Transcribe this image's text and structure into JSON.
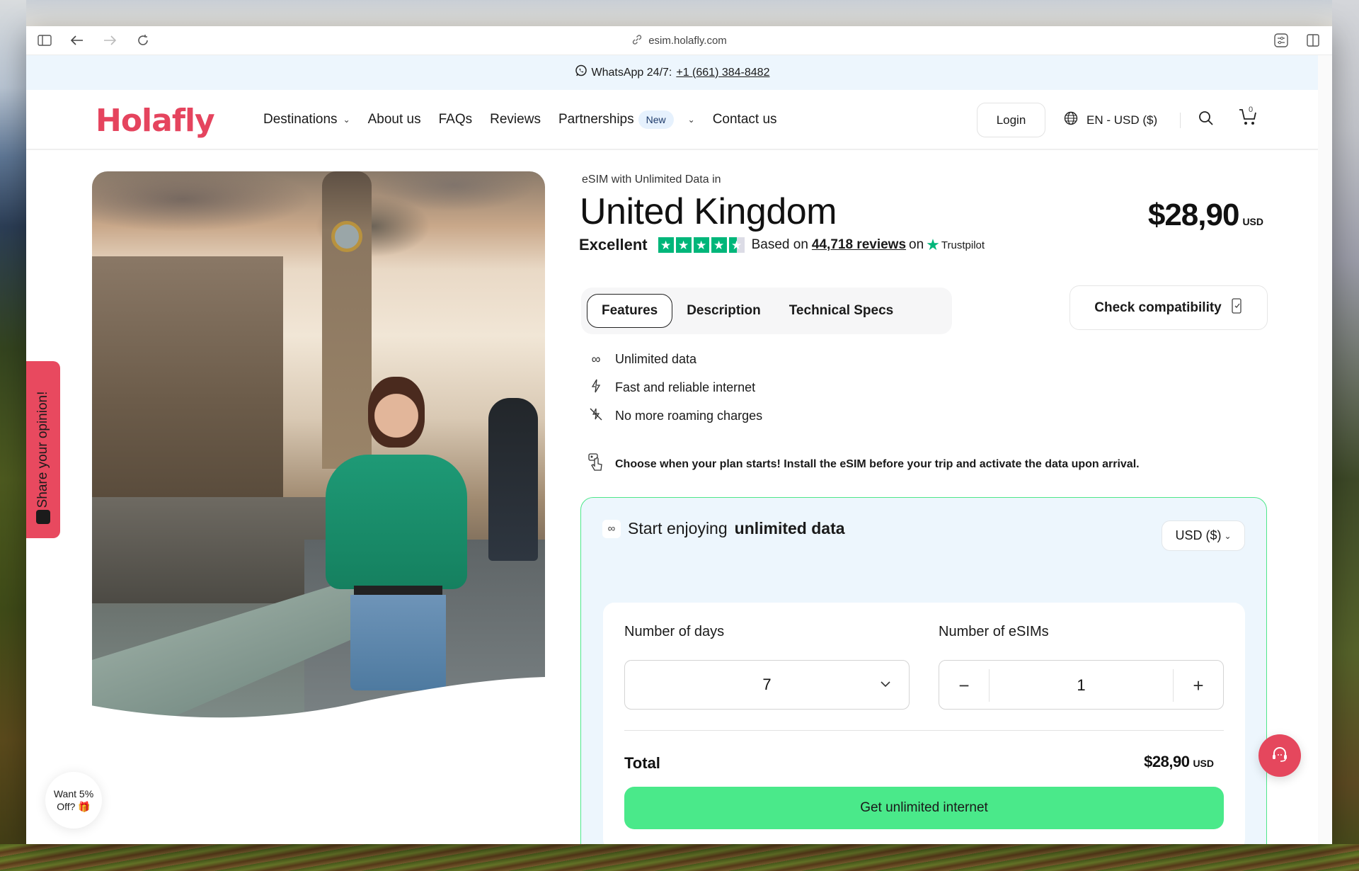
{
  "browser": {
    "url": "esim.holafly.com",
    "icons": [
      "sidebar-icon",
      "back-icon",
      "forward-icon",
      "reload-icon",
      "link-icon",
      "extensions-icon",
      "split-view-icon"
    ]
  },
  "banner": {
    "prefix": "WhatsApp 24/7:",
    "phone": "+1 (661) 384-8482",
    "icon": "whatsapp-icon"
  },
  "nav": {
    "logo": "Holafly",
    "links": [
      {
        "label": "Destinations",
        "dropdown": true
      },
      {
        "label": "About us"
      },
      {
        "label": "FAQs"
      },
      {
        "label": "Reviews"
      },
      {
        "label": "Partnerships",
        "badge": "New",
        "dropdown": true
      },
      {
        "label": "Contact us"
      }
    ],
    "login": "Login",
    "language": "EN - USD ($)",
    "cart_count": "0"
  },
  "product": {
    "eyebrow": "eSIM with Unlimited Data in",
    "country": "United Kingdom",
    "price": "$28,90",
    "currency": "USD",
    "rating": {
      "label": "Excellent",
      "stars": 4.5,
      "based_on": "Based on",
      "reviews": "44,718 reviews",
      "on": "on",
      "provider": "Trustpilot"
    },
    "tabs": [
      {
        "label": "Features",
        "active": true
      },
      {
        "label": "Description",
        "active": false
      },
      {
        "label": "Technical Specs",
        "active": false
      }
    ],
    "check_compatibility": "Check compatibility",
    "features": [
      {
        "icon": "infinity-icon",
        "glyph": "∞",
        "label": "Unlimited data"
      },
      {
        "icon": "lightning-icon",
        "glyph": "ϟ",
        "label": "Fast and reliable internet"
      },
      {
        "icon": "no-roaming-icon",
        "glyph": "⍀",
        "label": "No more roaming charges"
      }
    ],
    "note": "Choose when your plan starts! Install the eSIM before your trip and activate the data upon arrival."
  },
  "purchase": {
    "title_prefix": "Start enjoying",
    "title_bold": "unlimited data",
    "currency_select": "USD ($)",
    "days_label": "Number of days",
    "days_value": "7",
    "esims_label": "Number of eSIMs",
    "esims_value": "1",
    "total_label": "Total",
    "total_value": "$28,90",
    "total_currency": "USD",
    "cta": "Get unlimited internet"
  },
  "widgets": {
    "feedback": "Share your opinion!",
    "discount_line1": "Want 5%",
    "discount_line2": "Off? 🎁"
  },
  "colors": {
    "brand": "#e5445e",
    "cta": "#4ae98a",
    "trustpilot": "#00b67a",
    "banner_bg": "#edf6fd"
  }
}
